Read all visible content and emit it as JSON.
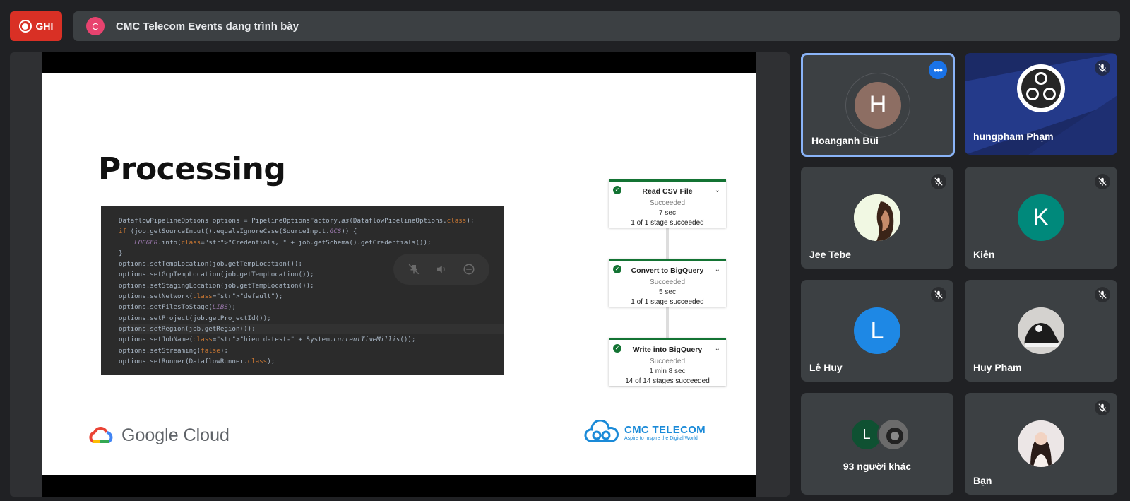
{
  "top_bar": {
    "record_label": "GHI",
    "presenter_initial": "C",
    "presenter_text": "CMC Telecom Events đang trình bày"
  },
  "slide": {
    "title": "Processing",
    "code_lines": [
      "DataflowPipelineOptions options = PipelineOptionsFactory.as(DataflowPipelineOptions.class);",
      "if (job.getSourceInput().equalsIgnoreCase(SourceInput.GCS)) {",
      "    LOGGER.info(\"Credentials, \" + job.getSchema().getCredentials());",
      "}",
      "options.setTempLocation(job.getTempLocation());",
      "options.setGcpTempLocation(job.getTempLocation());",
      "options.setStagingLocation(job.getTempLocation());",
      "options.setNetwork(\"default\");",
      "options.setFilesToStage(LIBS);",
      "options.setProject(job.getProjectId());",
      "options.setRegion(job.getRegion());",
      "options.setJobName(\"hieutd-test-\" + System.currentTimeMillis());",
      "options.setStreaming(false);",
      "options.setRunner(DataflowRunner.class);"
    ],
    "pipeline": [
      {
        "name": "Read CSV File",
        "status": "Succeeded",
        "time": "7 sec",
        "stages": "1 of 1 stage succeeded"
      },
      {
        "name": "Convert to BigQuery",
        "status": "Succeeded",
        "time": "5 sec",
        "stages": "1 of 1 stage succeeded"
      },
      {
        "name": "Write into BigQuery",
        "status": "Succeeded",
        "time": "1 min 8 sec",
        "stages": "14 of 14 stages succeeded"
      }
    ],
    "google_cloud_label": "Google Cloud",
    "cmc_name": "CMC TELECOM",
    "cmc_slogan": "Aspire to Inspire the Digital World"
  },
  "participants": [
    {
      "name": "Hoanganh Bui",
      "initial": "H",
      "avatar_color": "#8d6e63",
      "active": true
    },
    {
      "name": "hungpham Phạm",
      "initial": "",
      "muted": true
    },
    {
      "name": "Jee Tebe",
      "initial": "",
      "muted": true
    },
    {
      "name": "Kiên",
      "initial": "K",
      "avatar_color": "#00897b",
      "muted": true
    },
    {
      "name": "Lê Huy",
      "initial": "L",
      "avatar_color": "#1e88e5",
      "muted": true
    },
    {
      "name": "Huy Pham",
      "initial": "",
      "muted": true
    },
    {
      "name": "93 người khác",
      "initial": "L",
      "avatar_color": "#0f5132"
    },
    {
      "name": "Bạn",
      "initial": "",
      "muted": true
    }
  ],
  "colors": {
    "record": "#d93025",
    "active_border": "#8ab4f8",
    "pipeline_green": "#137333"
  }
}
